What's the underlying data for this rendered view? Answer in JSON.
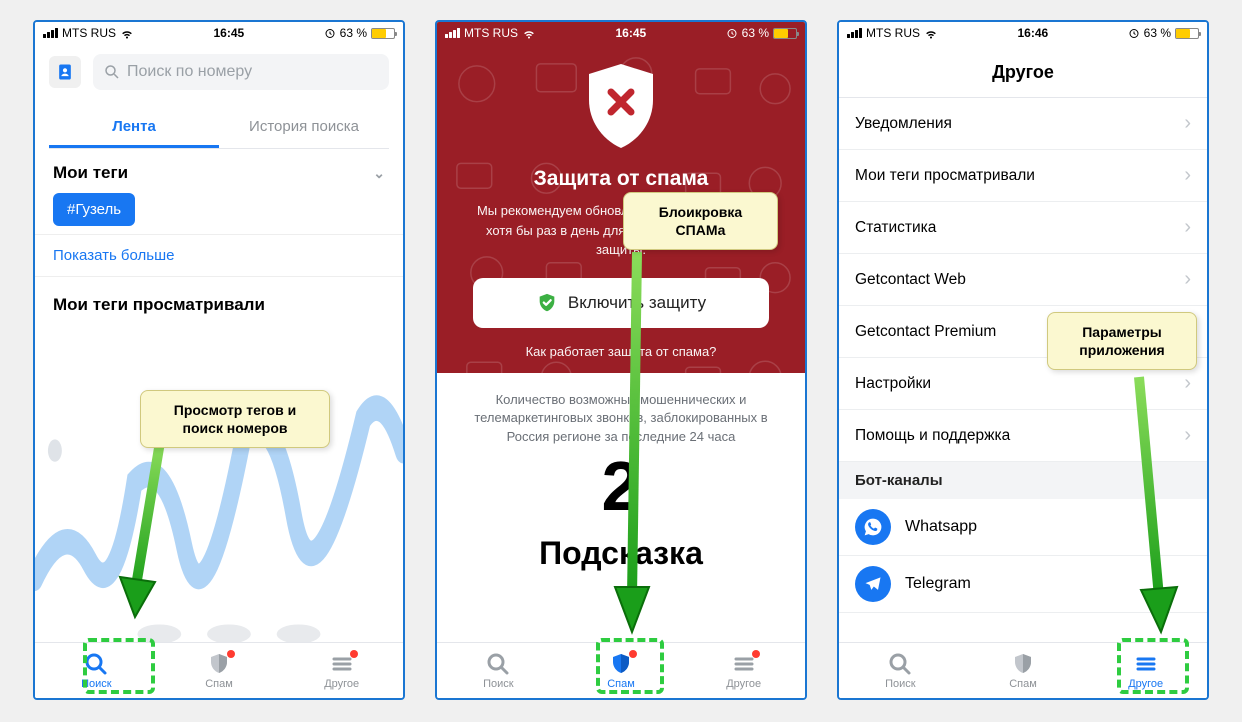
{
  "status": {
    "carrier": "MTS RUS",
    "time1": "16:45",
    "time2": "16:45",
    "time3": "16:46",
    "battery": "63 %"
  },
  "p1": {
    "search_placeholder": "Поиск по номеру",
    "tab_feed": "Лента",
    "tab_history": "История поиска",
    "my_tags": "Мои теги",
    "tag": "#Гузель",
    "show_more": "Показать больше",
    "views_title": "Мои теги просматривали",
    "callout": "Просмотр тегов и поиск номеров"
  },
  "p2": {
    "title": "Защита от спама",
    "desc": "Мы рекомендуем обновлять список блокировки хотя бы раз в день для обеспечения лучшей защиты.",
    "enable": "Включить защиту",
    "how": "Как работает защита от спама?",
    "counter_desc": "Количество возможных мошеннических и телемаркетинговых звонков, заблокированных в Россия регионе за последние 24 часа",
    "big": "2",
    "hint": "Подсказка",
    "callout": "Блоикровка СПАМа"
  },
  "p3": {
    "title": "Другое",
    "items": [
      "Уведомления",
      "Мои теги просматривали",
      "Статистика",
      "Getcontact Web",
      "Getcontact Premium",
      "Настройки",
      "Помощь и поддержка"
    ],
    "bot_header": "Бот-каналы",
    "bot1": "Whatsapp",
    "bot2": "Telegram",
    "callout": "Параметры приложения"
  },
  "nav": {
    "search": "Поиск",
    "spam": "Спам",
    "other": "Другое"
  }
}
